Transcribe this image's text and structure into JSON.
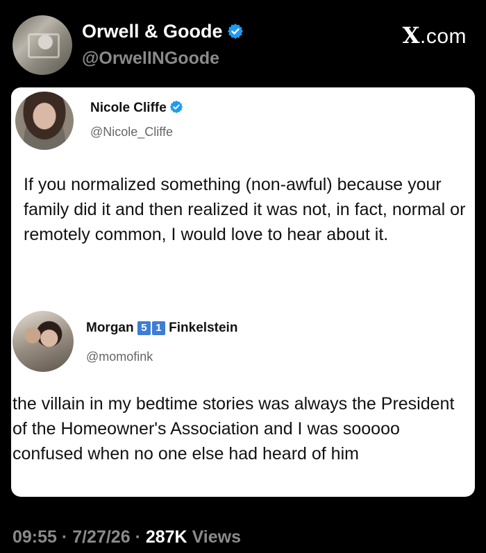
{
  "header": {
    "display_name": "Orwell & Goode",
    "handle": "@OrwellNGoode",
    "brand_x": "X",
    "brand_suffix": ".com"
  },
  "quoted_tweet": {
    "display_name": "Nicole Cliffe",
    "handle": "@Nicole_Cliffe",
    "text": "If you normalized something (non-awful) because your family did it and then realized it was not, in fact, normal or remotely common, I would love to hear about it."
  },
  "reply_tweet": {
    "name_first": "Morgan",
    "badge_digits": [
      "5",
      "1"
    ],
    "name_last": "Finkelstein",
    "handle": "@momofink",
    "text": "the villain in my bedtime stories was always the President of the Homeowner's Association and I was sooooo confused when no one else had heard of him"
  },
  "footer": {
    "time": "09:55",
    "separator": "·",
    "date": "7/27/26",
    "views_count": "287K",
    "views_label": "Views"
  },
  "colors": {
    "background": "#000000",
    "card": "#ffffff",
    "verified_blue": "#1d9bf0",
    "muted_gray": "#8a8a8a",
    "badge_blue": "#3d7dd6"
  },
  "icons": {
    "verified": "verified-badge-icon"
  }
}
